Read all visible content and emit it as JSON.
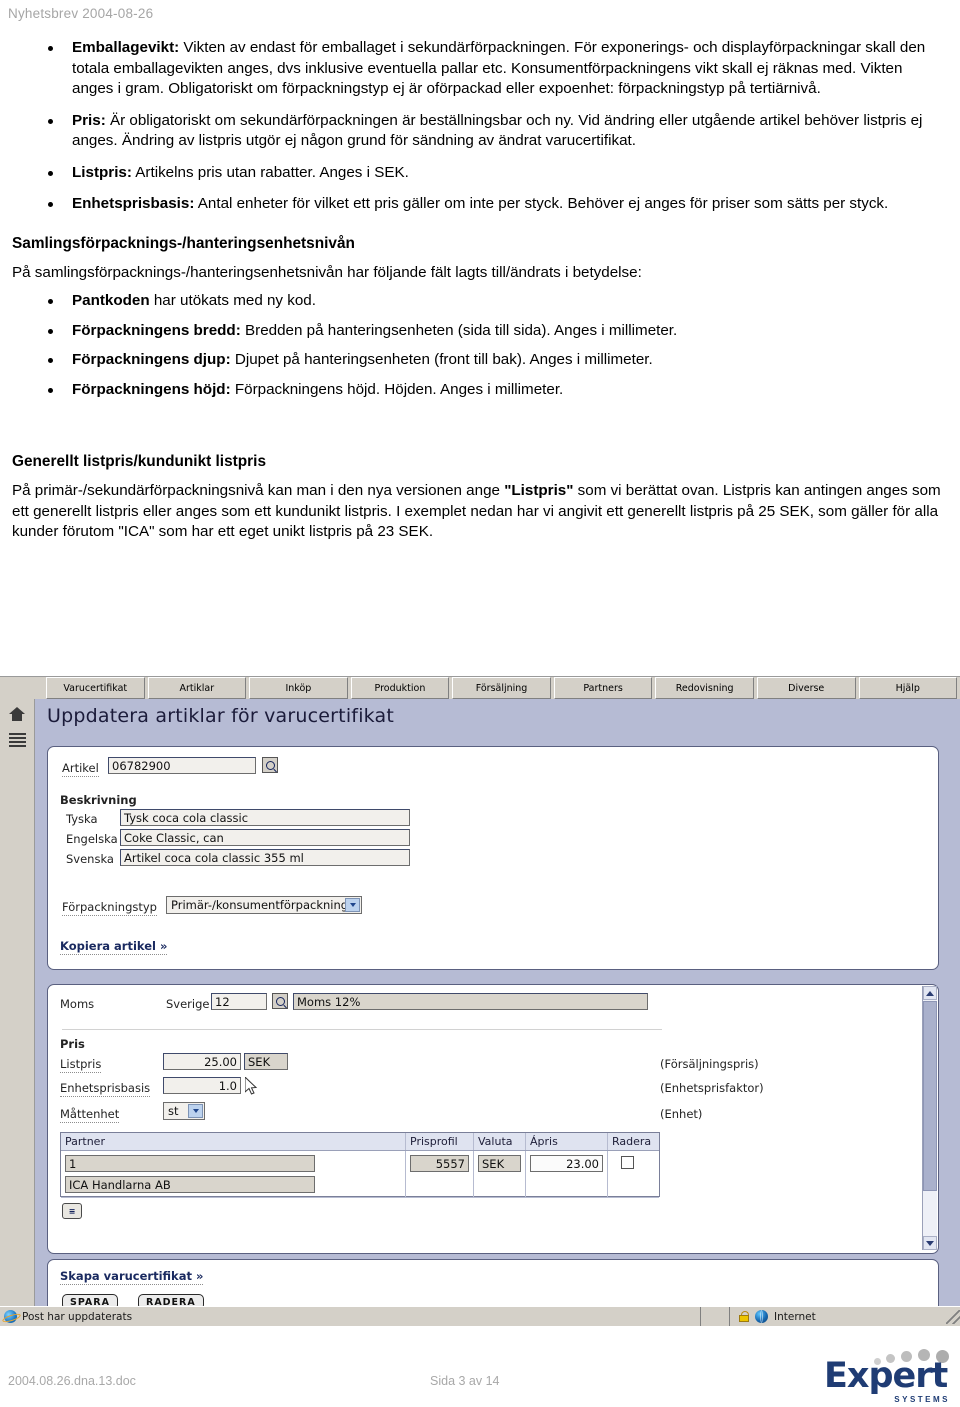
{
  "document": {
    "header": "Nyhetsbrev 2004-08-26",
    "footer_left": "2004.08.26.dna.13.doc",
    "footer_center": "Sida 3 av 14",
    "logo_word": "Expert",
    "logo_sub": "SYSTEMS"
  },
  "bullets_top": [
    {
      "term": "Emballagevikt:",
      "text": " Vikten av endast för emballaget i sekundärförpackningen. För exponerings- och displayförpackningar skall den totala emballagevikten anges, dvs inklusive eventuella pallar etc. Konsumentförpackningens vikt skall ej räknas med. Vikten anges i gram. Obligatoriskt om förpackningstyp ej är oförpackad eller expoenhet: förpackningstyp på tertiärnivå."
    },
    {
      "term": "Pris:",
      "text": " Är obligatoriskt om sekundärförpackningen är beställningsbar och ny. Vid ändring eller utgående artikel behöver listpris ej anges. Ändring av listpris utgör ej någon grund för sändning av ändrat varucertifikat."
    },
    {
      "term": "Listpris:",
      "text": " Artikelns pris utan rabatter. Anges i SEK."
    },
    {
      "term": "Enhetsprisbasis:",
      "text": " Antal enheter för vilket ett pris gäller om inte per styck. Behöver ej anges för priser som sätts per styck."
    }
  ],
  "section_collection": {
    "heading": "Samlingsförpacknings-/hanteringsenhetsnivån",
    "intro": "På samlingsförpacknings-/hanteringsenhetsnivån har följande fält lagts till/ändrats i betydelse:",
    "bullets": [
      {
        "term": "Pantkoden",
        "text": " har utökats med ny kod."
      },
      {
        "term": "Förpackningens bredd:",
        "text": " Bredden på hanteringsenheten (sida till sida). Anges i millimeter."
      },
      {
        "term": "Förpackningens djup:",
        "text": " Djupet på hanteringsenheten (front till bak). Anges i millimeter."
      },
      {
        "term": "Förpackningens höjd:",
        "text": " Förpackningens höjd. Höjden. Anges i millimeter."
      }
    ]
  },
  "section_price": {
    "heading": "Generellt listpris/kundunikt listpris",
    "para_a": "På primär-/sekundärförpackningsnivå kan man i den nya versionen ange ",
    "para_b_bold": "\"Listpris\"",
    "para_c": " som vi berättat ovan. Listpris kan antingen anges som ett generellt listpris eller anges som ett kundunikt listpris. I exemplet nedan har vi angivit ett generellt listpris på 25 SEK, som gäller för alla kunder förutom \"ICA\" som har ett eget unikt listpris på 23 SEK."
  },
  "app": {
    "tabs": [
      "Varucertifikat",
      "Artiklar",
      "Inköp",
      "Produktion",
      "Försäljning",
      "Partners",
      "Redovisning",
      "Diverse",
      "Hjälp"
    ],
    "page_title": "Uppdatera artiklar för varucertifikat",
    "artikel": {
      "label": "Artikel",
      "value": "06782900"
    },
    "beskrivning": {
      "group_label": "Beskrivning",
      "rows": [
        {
          "label": "Tyska",
          "value": "Tysk coca cola classic"
        },
        {
          "label": "Engelska",
          "value": "Coke Classic, can"
        },
        {
          "label": "Svenska",
          "value": "Artikel coca cola classic 355 ml"
        }
      ]
    },
    "forpackningstyp": {
      "label": "Förpackningstyp",
      "value": "Primär-/konsumentförpackning"
    },
    "kopiera_link": "Kopiera artikel »",
    "moms": {
      "label": "Moms",
      "country_label": "Sverige",
      "code": "12",
      "description": "Moms 12%"
    },
    "pris": {
      "group_label": "Pris",
      "listpris_label": "Listpris",
      "listpris_value": "25.00",
      "listpris_currency": "SEK",
      "listpris_hint": "(Försäljningspris)",
      "enhetsprisbasis_label": "Enhetsprisbasis",
      "enhetsprisbasis_value": "1.0",
      "enhetsprisbasis_hint": "(Enhetsprisfaktor)",
      "mattenhet_label": "Måttenhet",
      "mattenhet_value": "st",
      "mattenhet_hint": "(Enhet)"
    },
    "partner_table": {
      "columns": [
        "Partner",
        "Prisprofil",
        "Valuta",
        "Ápris",
        "Radera"
      ],
      "rows": [
        {
          "partner_id": "1",
          "partner_name": "ICA Handlarna AB",
          "prisprofil": "5557",
          "valuta": "SEK",
          "apris": "23.00",
          "radera_checked": false
        }
      ],
      "add_button": "add-row"
    },
    "actions": {
      "skapa_link": "Skapa varucertifikat »",
      "spara": "SPARA",
      "radera": "RADERA"
    },
    "statusbar": {
      "message": "Post har uppdaterats",
      "zone": "Internet"
    }
  }
}
